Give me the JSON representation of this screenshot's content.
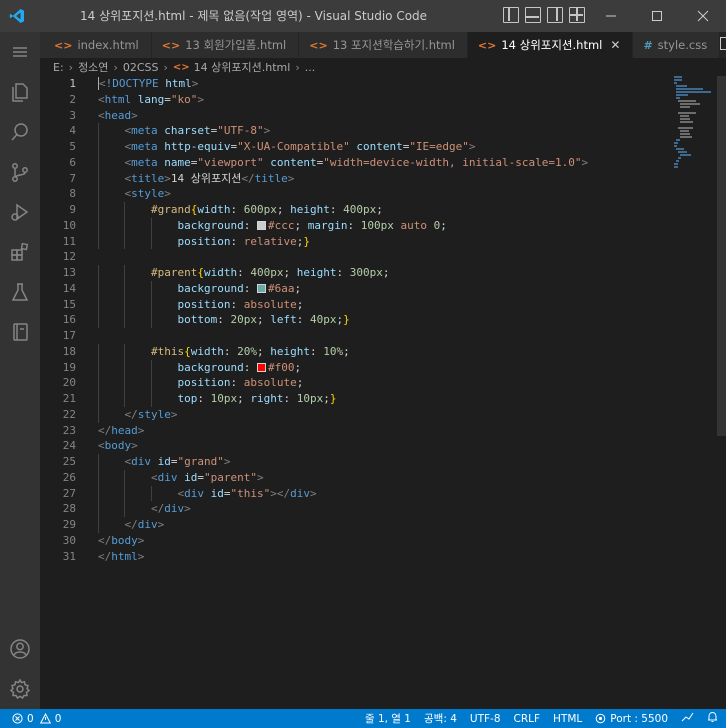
{
  "window": {
    "title": "14 상위포지션.html - 제목 없음(작업 영역) - Visual Studio Code",
    "brand_color": "#007acc"
  },
  "tabs": [
    {
      "label": "index.html",
      "icon": "html-icon",
      "active": false,
      "icon_color": "#e37933"
    },
    {
      "label": "13 회원가입폼.html",
      "icon": "html-icon",
      "active": false,
      "icon_color": "#e37933"
    },
    {
      "label": "13 포지션학습하기.html",
      "icon": "html-icon",
      "active": false,
      "icon_color": "#e37933"
    },
    {
      "label": "14 상위포지션.html",
      "icon": "html-icon",
      "active": true,
      "icon_color": "#e37933"
    },
    {
      "label": "style.css",
      "icon": "css-icon",
      "active": false,
      "icon_color": "#519aba"
    }
  ],
  "breadcrumb": [
    "E:",
    "정소연",
    "02CSS",
    "14 상위포지션.html",
    "..."
  ],
  "editor": {
    "current_line": 1,
    "lines": [
      "<!DOCTYPE html>",
      "<html lang=\"ko\">",
      "<head>",
      "    <meta charset=\"UTF-8\">",
      "    <meta http-equiv=\"X-UA-Compatible\" content=\"IE=edge\">",
      "    <meta name=\"viewport\" content=\"width=device-width, initial-scale=1.0\">",
      "    <title>14 상위포지션</title>",
      "    <style>",
      "        #grand{width: 600px; height: 400px;",
      "            background: #ccc; margin: 100px auto 0;",
      "            position: relative;}",
      "",
      "        #parent{width: 400px; height: 300px;",
      "            background: #6aa;",
      "            position: absolute;",
      "            bottom: 20px; left: 40px;}",
      "",
      "        #this{width: 20%; height: 10%;",
      "            background: #f00;",
      "            position: absolute;",
      "            top: 10px; right: 10px;}",
      "    </style>",
      "</head>",
      "<body>",
      "    <div id=\"grand\">",
      "        <div id=\"parent\">",
      "            <div id=\"this\"></div>",
      "        </div>",
      "    </div>",
      "</body>",
      "</html>"
    ]
  },
  "statusbar": {
    "errors": "0",
    "warnings": "0",
    "position": "줄 1, 열 1",
    "spaces": "공백: 4",
    "encoding": "UTF-8",
    "eol": "CRLF",
    "language": "HTML",
    "port": "Port : 5500"
  }
}
